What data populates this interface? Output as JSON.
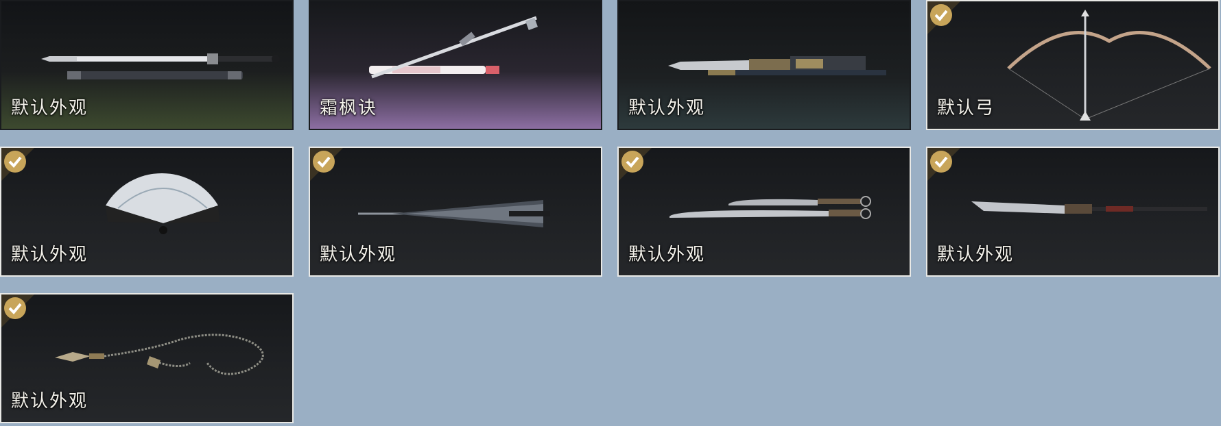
{
  "items": [
    {
      "label": "默认外观",
      "selected": false,
      "weapon": "sword-icon"
    },
    {
      "label": "霜枫诀",
      "selected": false,
      "weapon": "sword-icon"
    },
    {
      "label": "默认外观",
      "selected": false,
      "weapon": "spear-blade-icon"
    },
    {
      "label": "默认弓",
      "selected": true,
      "weapon": "bow-icon"
    },
    {
      "label": "默认外观",
      "selected": true,
      "weapon": "fan-icon"
    },
    {
      "label": "默认外观",
      "selected": true,
      "weapon": "umbrella-icon"
    },
    {
      "label": "默认外观",
      "selected": true,
      "weapon": "dual-blades-icon"
    },
    {
      "label": "默认外观",
      "selected": true,
      "weapon": "glaive-icon"
    },
    {
      "label": "默认外观",
      "selected": true,
      "weapon": "rope-dart-icon"
    }
  ],
  "colors": {
    "background": "#9aafc4",
    "card": "#1f2124",
    "selected_border": "#e9e9e6",
    "check_gold": "#c8a55a"
  }
}
